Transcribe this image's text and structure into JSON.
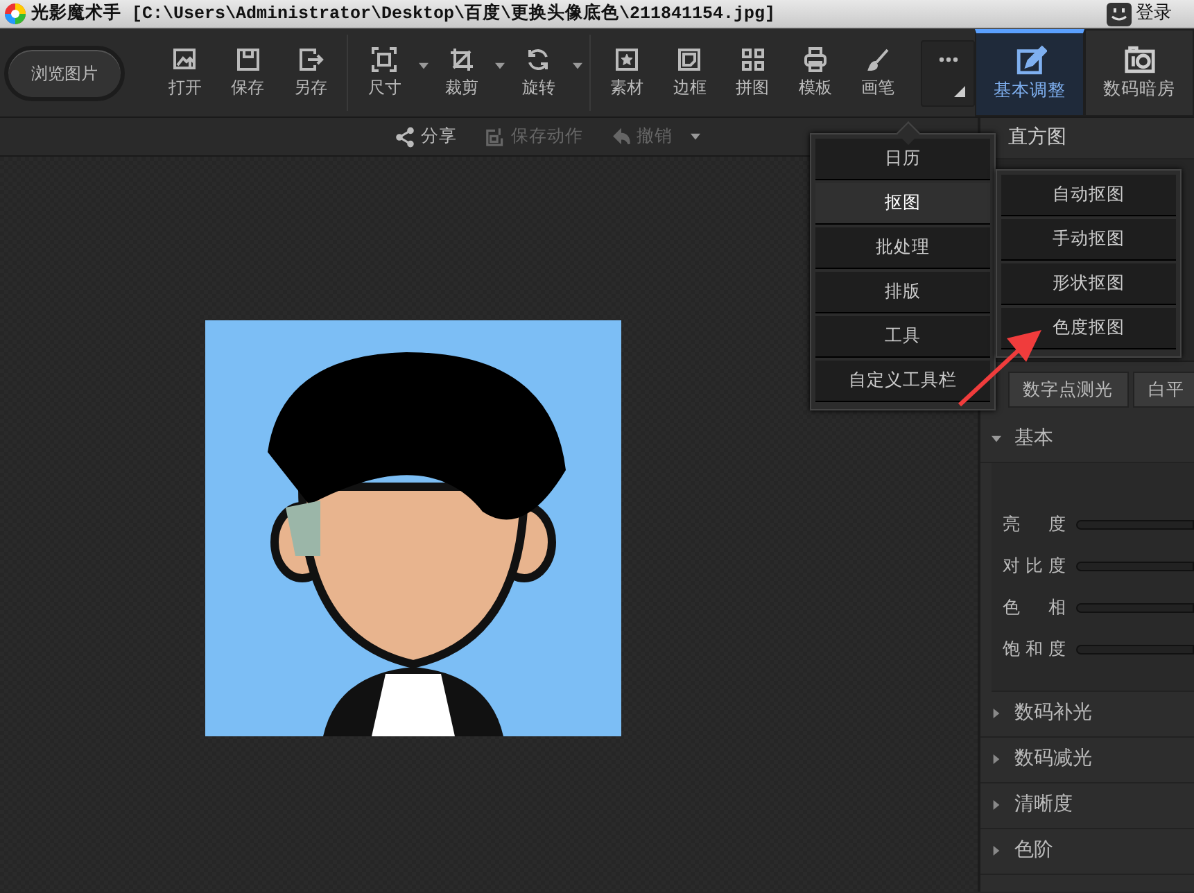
{
  "window": {
    "title": "光影魔术手  [C:\\Users\\Administrator\\Desktop\\百度\\更换头像底色\\211841154.jpg]",
    "login": "登录"
  },
  "toolbar": {
    "browse_button": "浏览图片",
    "groups": [
      [
        {
          "label": "打开",
          "dropdown": false
        },
        {
          "label": "保存",
          "dropdown": false
        },
        {
          "label": "另存",
          "dropdown": false
        }
      ],
      [
        {
          "label": "尺寸",
          "dropdown": true
        },
        {
          "label": "裁剪",
          "dropdown": true
        },
        {
          "label": "旋转",
          "dropdown": true
        }
      ],
      [
        {
          "label": "素材",
          "dropdown": false
        },
        {
          "label": "边框",
          "dropdown": false
        },
        {
          "label": "拼图",
          "dropdown": false
        },
        {
          "label": "模板",
          "dropdown": false
        },
        {
          "label": "画笔",
          "dropdown": false
        }
      ]
    ]
  },
  "right_tabs": [
    {
      "label": "基本调整",
      "selected": true
    },
    {
      "label": "数码暗房",
      "selected": false
    }
  ],
  "action_bar": [
    {
      "label": "分享",
      "disabled": false,
      "dropdown": false
    },
    {
      "label": "保存动作",
      "disabled": true,
      "dropdown": false
    },
    {
      "label": "撤销",
      "disabled": true,
      "dropdown": true
    }
  ],
  "menu": [
    {
      "label": "日历",
      "highlighted": false
    },
    {
      "label": "抠图",
      "highlighted": true
    },
    {
      "label": "批处理",
      "highlighted": false
    },
    {
      "label": "排版",
      "highlighted": false
    },
    {
      "label": "工具",
      "highlighted": false
    },
    {
      "label": "自定义工具栏",
      "highlighted": false
    }
  ],
  "submenu": [
    {
      "label": "自动抠图"
    },
    {
      "label": "手动抠图"
    },
    {
      "label": "形状抠图"
    },
    {
      "label": "色度抠图"
    }
  ],
  "panel": {
    "histogram_title": "直方图",
    "buttons": [
      "数字点测光",
      "白平"
    ],
    "sections": [
      {
        "label": "基本",
        "expanded": true,
        "sliders": [
          {
            "label": "亮度"
          },
          {
            "label": "对比度"
          },
          {
            "label": "色相"
          },
          {
            "label": "饱和度"
          }
        ]
      },
      {
        "label": "数码补光",
        "expanded": false
      },
      {
        "label": "数码减光",
        "expanded": false
      },
      {
        "label": "清晰度",
        "expanded": false
      },
      {
        "label": "色阶",
        "expanded": false
      }
    ]
  }
}
